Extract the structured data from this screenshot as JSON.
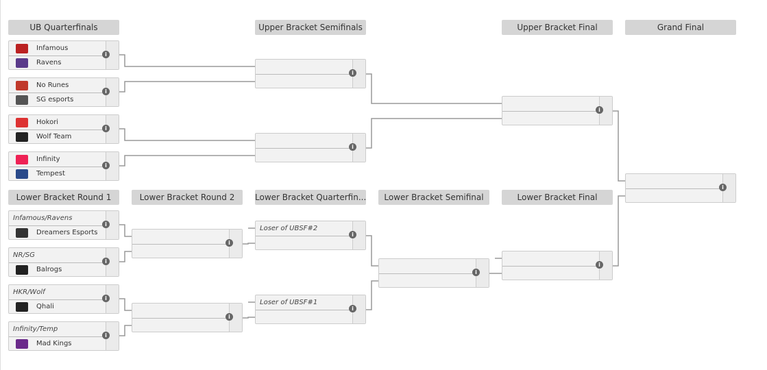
{
  "headers": [
    "UB Quarterfinals",
    "Upper Bracket Semifinals",
    "Upper Bracket Final",
    "Grand Final",
    "Lower Bracket Round 1",
    "Lower Bracket Round 2",
    "Lower Bracket Quarterfin...",
    "Lower Bracket Semifinal",
    "Lower Bracket Final"
  ],
  "matches": [
    {
      "top": {
        "name": "Infamous",
        "logo": "#b22"
      },
      "bot": {
        "name": "Ravens",
        "logo": "#5a3a8a"
      }
    },
    {
      "top": {
        "name": "No Runes",
        "logo": "#c0392b"
      },
      "bot": {
        "name": "SG esports",
        "logo": "#555"
      }
    },
    {
      "top": {
        "name": "Hokori",
        "logo": "#d33"
      },
      "bot": {
        "name": "Wolf Team",
        "logo": "#222"
      }
    },
    {
      "top": {
        "name": "Infinity",
        "logo": "#e25"
      },
      "bot": {
        "name": "Tempest",
        "logo": "#2a4a8a"
      }
    },
    {
      "top": {},
      "bot": {}
    },
    {
      "top": {},
      "bot": {}
    },
    {
      "top": {},
      "bot": {}
    },
    {
      "top": {},
      "bot": {}
    },
    {
      "top": {
        "placeholder": "Infamous/Ravens"
      },
      "bot": {
        "name": "Dreamers Esports",
        "logo": "#333"
      }
    },
    {
      "top": {
        "placeholder": "NR/SG"
      },
      "bot": {
        "name": "Balrogs",
        "logo": "#222"
      }
    },
    {
      "top": {
        "placeholder": "HKR/Wolf"
      },
      "bot": {
        "name": "Qhali",
        "logo": "#222"
      }
    },
    {
      "top": {
        "placeholder": "Infinity/Temp"
      },
      "bot": {
        "name": "Mad Kings",
        "logo": "#6a2a8a"
      }
    },
    {
      "top": {},
      "bot": {}
    },
    {
      "top": {},
      "bot": {}
    },
    {
      "top": {
        "placeholder": "Loser of UBSF#2"
      },
      "bot": {}
    },
    {
      "top": {
        "placeholder": "Loser of UBSF#1"
      },
      "bot": {}
    },
    {
      "top": {},
      "bot": {}
    },
    {
      "top": {},
      "bot": {}
    }
  ],
  "info_icon": "info-icon"
}
